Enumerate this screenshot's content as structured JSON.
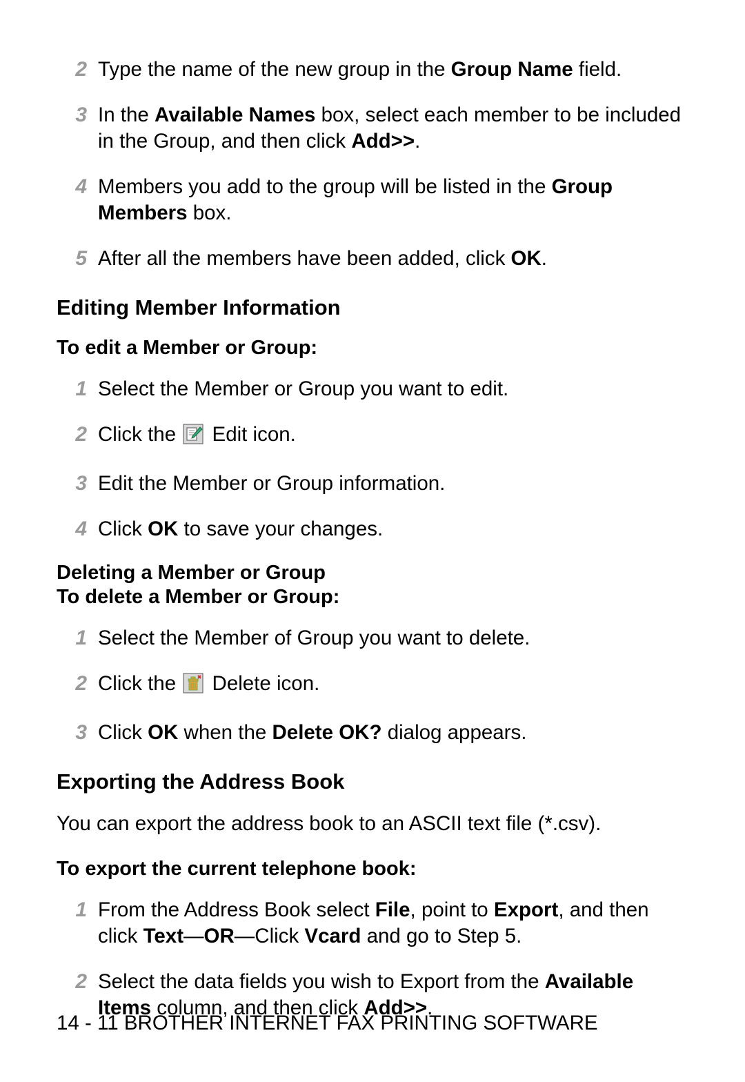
{
  "listA": {
    "n2": "2",
    "t2_a": "Type the name of the new group in the ",
    "t2_b": "Group Name",
    "t2_c": " field.",
    "n3": "3",
    "t3_a": "In the ",
    "t3_b": "Available Names",
    "t3_c": " box, select each member to be included in the Group, and then click ",
    "t3_d": "Add>>",
    "t3_e": ".",
    "n4": "4",
    "t4_a": "Members you add to the group will be listed in the ",
    "t4_b": "Group Members",
    "t4_c": " box.",
    "n5": "5",
    "t5_a": "After all the members have been added, click ",
    "t5_b": "OK",
    "t5_c": "."
  },
  "h_edit": "Editing Member Information",
  "h_edit_sub": "To edit a Member or Group:",
  "listB": {
    "n1": "1",
    "t1": "Select the Member or Group you want to edit.",
    "n2": "2",
    "t2_a": "Click the ",
    "t2_b": " Edit icon.",
    "n3": "3",
    "t3": "Edit the Member or Group information.",
    "n4": "4",
    "t4_a": "Click ",
    "t4_b": "OK",
    "t4_c": " to save your changes."
  },
  "h_del": "Deleting a Member or Group",
  "h_del_sub": "To delete a Member or Group:",
  "listC": {
    "n1": "1",
    "t1": "Select the Member of Group you want to delete.",
    "n2": "2",
    "t2_a": "Click the ",
    "t2_b": " Delete icon.",
    "n3": "3",
    "t3_a": "Click ",
    "t3_b": "OK",
    "t3_c": " when the ",
    "t3_d": "Delete OK?",
    "t3_e": " dialog appears."
  },
  "h_exp": "Exporting the Address Book",
  "exp_intro": "You can export the address book to an ASCII text file (*.csv).",
  "h_exp_sub": "To export the current telephone book:",
  "listD": {
    "n1": "1",
    "t1_a": "From the Address Book select ",
    "t1_b": "File",
    "t1_c": ", point to ",
    "t1_d": "Export",
    "t1_e": ", and then click ",
    "t1_f": "Text",
    "t1_g": "—",
    "t1_h": "OR",
    "t1_i": "—Click ",
    "t1_j": "Vcard",
    "t1_k": " and go to Step 5.",
    "n2": "2",
    "t2_a": "Select the data fields you wish to Export from the ",
    "t2_b": "Available Items",
    "t2_c": " column, and then click ",
    "t2_d": "Add>>",
    "t2_e": "."
  },
  "footer": "14 - 11 BROTHER INTERNET FAX PRINTING SOFTWARE"
}
